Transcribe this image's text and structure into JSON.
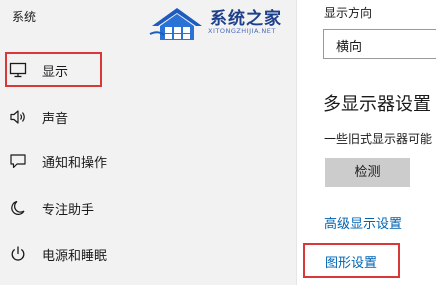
{
  "app_title": "系统",
  "watermark": {
    "name": "系统之家",
    "url": "XITONGZHIJIA.NET"
  },
  "sidebar": {
    "items": [
      {
        "label": "显示",
        "icon": "monitor-icon"
      },
      {
        "label": "声音",
        "icon": "speaker-icon"
      },
      {
        "label": "通知和操作",
        "icon": "message-icon"
      },
      {
        "label": "专注助手",
        "icon": "moon-icon"
      },
      {
        "label": "电源和睡眠",
        "icon": "power-icon"
      }
    ]
  },
  "main": {
    "orientation_label": "显示方向",
    "orientation_value": "横向",
    "multi_display_heading": "多显示器设置",
    "legacy_note": "一些旧式显示器可能",
    "detect_button": "检测",
    "advanced_link": "高级显示设置",
    "graphics_link": "图形设置"
  },
  "colors": {
    "highlight_border": "#d9383a",
    "link": "#0063b1",
    "sidebar_bg": "#f2f2f2",
    "watermark": "#1e3f8a"
  }
}
